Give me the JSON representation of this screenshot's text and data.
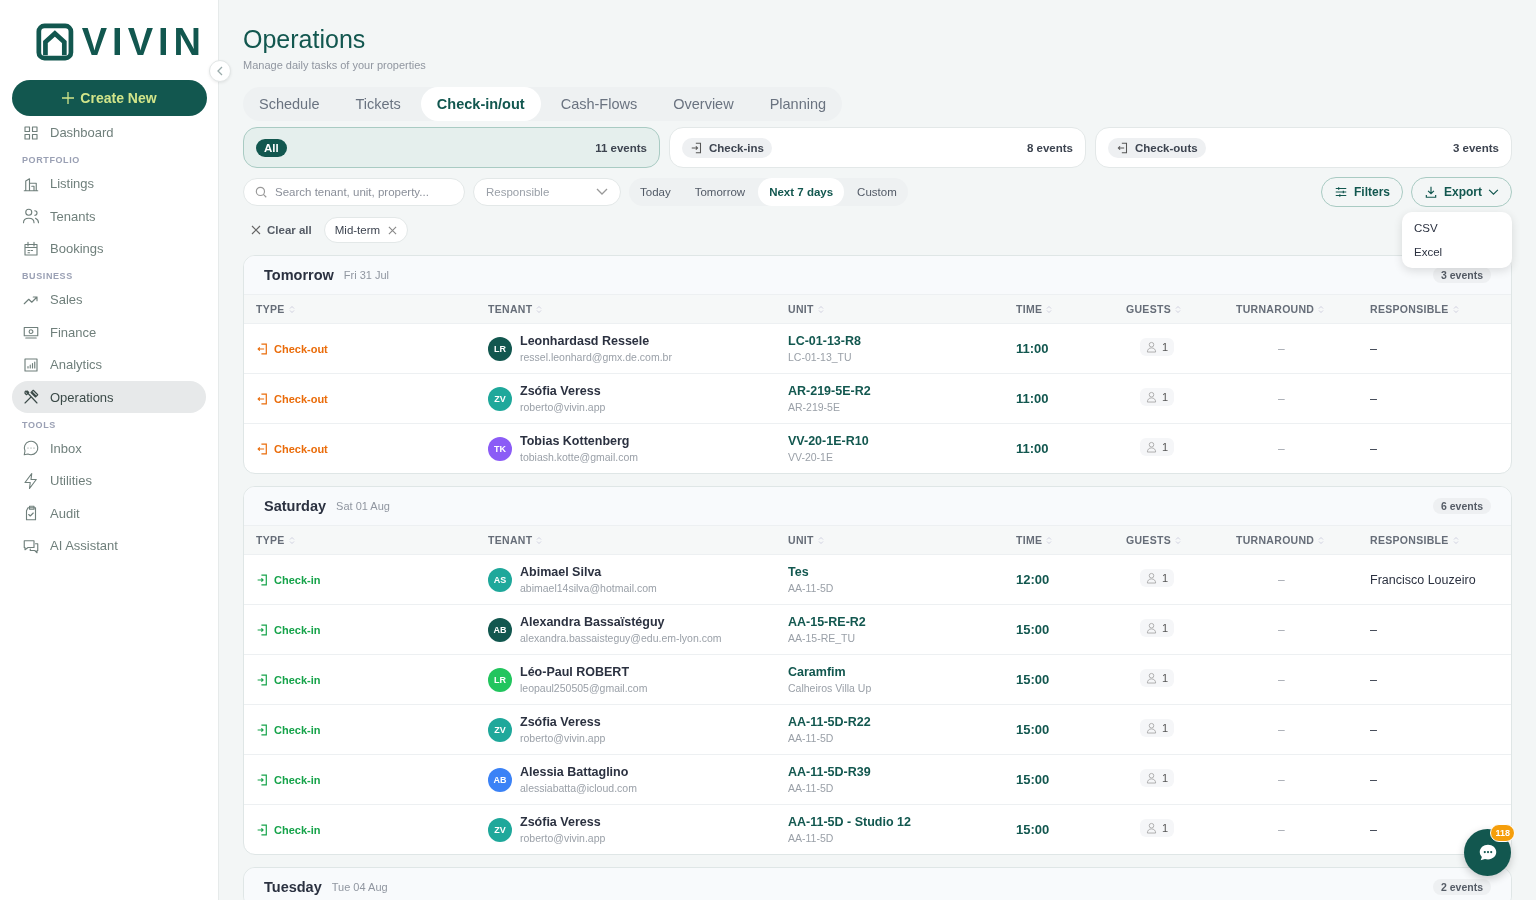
{
  "brand": {
    "logo": "VIVIN"
  },
  "create_button": {
    "label": "Create New"
  },
  "sidebar": {
    "sections": [
      {
        "items": [
          {
            "label": "Dashboard",
            "selected": false
          }
        ]
      },
      {
        "heading": "PORTFOLIO",
        "items": [
          {
            "label": "Listings",
            "selected": false
          },
          {
            "label": "Tenants",
            "selected": false
          },
          {
            "label": "Bookings",
            "selected": false
          }
        ]
      },
      {
        "heading": "BUSINESS",
        "items": [
          {
            "label": "Sales",
            "selected": false
          },
          {
            "label": "Finance",
            "selected": false
          },
          {
            "label": "Analytics",
            "selected": false
          },
          {
            "label": "Operations",
            "selected": true
          }
        ]
      },
      {
        "heading": "TOOLS",
        "items": [
          {
            "label": "Inbox",
            "selected": false
          },
          {
            "label": "Utilities",
            "selected": false
          },
          {
            "label": "Audit",
            "selected": false
          },
          {
            "label": "AI Assistant",
            "selected": false
          }
        ]
      }
    ]
  },
  "page": {
    "title": "Operations",
    "subtitle": "Manage daily tasks of your properties"
  },
  "tabs": [
    {
      "label": "Schedule",
      "selected": false
    },
    {
      "label": "Tickets",
      "selected": false
    },
    {
      "label": "Check-in/out",
      "selected": true
    },
    {
      "label": "Cash-Flows",
      "selected": false
    },
    {
      "label": "Overview",
      "selected": false
    },
    {
      "label": "Planning",
      "selected": false
    }
  ],
  "stat_cards": [
    {
      "kind": "all",
      "label": "All",
      "count": "11 events",
      "selected": true
    },
    {
      "kind": "checkin",
      "label": "Check-ins",
      "count": "8 events",
      "selected": false
    },
    {
      "kind": "checkout",
      "label": "Check-outs",
      "count": "3 events",
      "selected": false
    }
  ],
  "search": {
    "placeholder": "Search tenant, unit, property..."
  },
  "responsible_select": {
    "placeholder": "Responsible"
  },
  "date_ranges": [
    {
      "label": "Today",
      "selected": false
    },
    {
      "label": "Tomorrow",
      "selected": false
    },
    {
      "label": "Next 7 days",
      "selected": true
    },
    {
      "label": "Custom",
      "selected": false
    }
  ],
  "filters_button": {
    "label": "Filters"
  },
  "export_button": {
    "label": "Export"
  },
  "export_menu": [
    "CSV",
    "Excel"
  ],
  "active_filters": {
    "clear_label": "Clear all",
    "chips": [
      "Mid-term"
    ]
  },
  "groups": [
    {
      "day": "Tomorrow",
      "date": "Fri 31 Jul",
      "count": "3 events",
      "columns": [
        "TYPE",
        "TENANT",
        "UNIT",
        "TIME",
        "GUESTS",
        "TURNAROUND",
        "RESPONSIBLE"
      ],
      "rows": [
        {
          "kind": "checkout",
          "type": "Check-out",
          "initials": "LR",
          "color": "#12574f",
          "name": "Leonhardasd Ressele",
          "email": "ressel.leonhard@gmx.de.com.br",
          "unit": "LC-01-13-R8",
          "unit_sub": "LC-01-13_TU",
          "time": "11:00",
          "guests": "1",
          "turnaround": "–",
          "responsible": "–"
        },
        {
          "kind": "checkout",
          "type": "Check-out",
          "initials": "ZV",
          "color": "#1fa89b",
          "name": "Zsófia Veress",
          "email": "roberto@vivin.app",
          "unit": "AR-219-5E-R2",
          "unit_sub": "AR-219-5E",
          "time": "11:00",
          "guests": "1",
          "turnaround": "–",
          "responsible": "–"
        },
        {
          "kind": "checkout",
          "type": "Check-out",
          "initials": "TK",
          "color": "#8b5cf6",
          "name": "Tobias Kottenberg",
          "email": "tobiash.kotte@gmail.com",
          "unit": "VV-20-1E-R10",
          "unit_sub": "VV-20-1E",
          "time": "11:00",
          "guests": "1",
          "turnaround": "–",
          "responsible": "–"
        }
      ]
    },
    {
      "day": "Saturday",
      "date": "Sat 01 Aug",
      "count": "6 events",
      "columns": [
        "TYPE",
        "TENANT",
        "UNIT",
        "TIME",
        "GUESTS",
        "TURNAROUND",
        "RESPONSIBLE"
      ],
      "rows": [
        {
          "kind": "checkin",
          "type": "Check-in",
          "initials": "AS",
          "color": "#1fa89b",
          "name": "Abimael Silva",
          "email": "abimael14silva@hotmail.com",
          "unit": "Tes",
          "unit_sub": "AA-11-5D",
          "time": "12:00",
          "guests": "1",
          "turnaround": "–",
          "responsible": "Francisco Louzeiro"
        },
        {
          "kind": "checkin",
          "type": "Check-in",
          "initials": "AB",
          "color": "#12574f",
          "name": "Alexandra Bassaïstéguy",
          "email": "alexandra.bassaisteguy@edu.em-lyon.com",
          "unit": "AA-15-RE-R2",
          "unit_sub": "AA-15-RE_TU",
          "time": "15:00",
          "guests": "1",
          "turnaround": "–",
          "responsible": "–"
        },
        {
          "kind": "checkin",
          "type": "Check-in",
          "initials": "LR",
          "color": "#22c55e",
          "name": "Léo-Paul ROBERT",
          "email": "leopaul250505@gmail.com",
          "unit": "Caramfim",
          "unit_sub": "Calheiros Villa Up",
          "time": "15:00",
          "guests": "1",
          "turnaround": "–",
          "responsible": "–"
        },
        {
          "kind": "checkin",
          "type": "Check-in",
          "initials": "ZV",
          "color": "#1fa89b",
          "name": "Zsófia Veress",
          "email": "roberto@vivin.app",
          "unit": "AA-11-5D-R22",
          "unit_sub": "AA-11-5D",
          "time": "15:00",
          "guests": "1",
          "turnaround": "–",
          "responsible": "–"
        },
        {
          "kind": "checkin",
          "type": "Check-in",
          "initials": "AB",
          "color": "#3b82f6",
          "name": "Alessia Battaglino",
          "email": "alessiabatta@icloud.com",
          "unit": "AA-11-5D-R39",
          "unit_sub": "AA-11-5D",
          "time": "15:00",
          "guests": "1",
          "turnaround": "–",
          "responsible": "–"
        },
        {
          "kind": "checkin",
          "type": "Check-in",
          "initials": "ZV",
          "color": "#1fa89b",
          "name": "Zsófia Veress",
          "email": "roberto@vivin.app",
          "unit": "AA-11-5D - Studio 12",
          "unit_sub": "AA-11-5D",
          "time": "15:00",
          "guests": "1",
          "turnaround": "–",
          "responsible": "–"
        }
      ]
    },
    {
      "day": "Tuesday",
      "date": "Tue 04 Aug",
      "count": "2 events"
    }
  ],
  "chat": {
    "badge": "118"
  }
}
